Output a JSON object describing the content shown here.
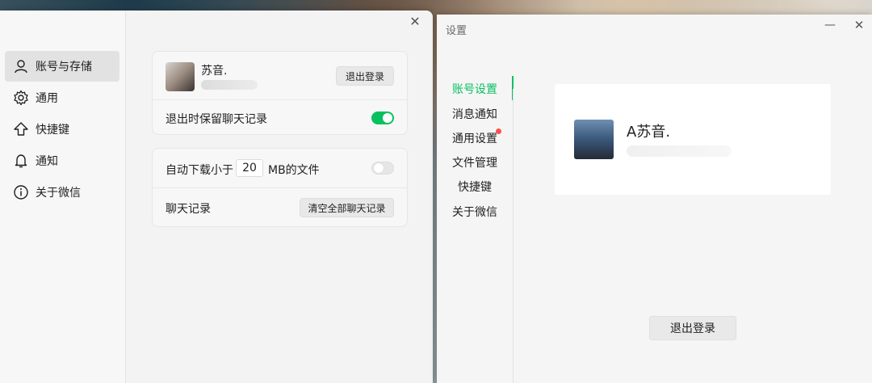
{
  "left_window": {
    "close_icon": "close-icon",
    "sidebar": {
      "items": [
        {
          "label": "账号与存储",
          "icon": "user-icon",
          "active": true
        },
        {
          "label": "通用",
          "icon": "gear-icon",
          "active": false
        },
        {
          "label": "快捷键",
          "icon": "shortcut-arrow-icon",
          "active": false
        },
        {
          "label": "通知",
          "icon": "bell-icon",
          "active": false
        },
        {
          "label": "关于微信",
          "icon": "info-icon",
          "active": false
        }
      ]
    },
    "account": {
      "nickname": "苏音.",
      "logout_label": "退出登录",
      "keep_history_label": "退出时保留聊天记录",
      "keep_history_on": true
    },
    "storage": {
      "auto_download_prefix": "自动下载小于",
      "auto_download_size": "20",
      "auto_download_suffix": "MB的文件",
      "auto_download_on": false,
      "history_label": "聊天记录",
      "clear_history_label": "清空全部聊天记录"
    }
  },
  "right_window": {
    "title": "设置",
    "minimize_icon": "minimize-icon",
    "close_icon": "close-icon",
    "nav": [
      {
        "label": "账号设置",
        "active": true
      },
      {
        "label": "消息通知",
        "active": false
      },
      {
        "label": "通用设置",
        "active": false,
        "badge": "red-dot"
      },
      {
        "label": "文件管理",
        "active": false
      },
      {
        "label": "快捷键",
        "active": false
      },
      {
        "label": "关于微信",
        "active": false
      }
    ],
    "profile": {
      "name": "A苏音."
    },
    "logout_label": "退出登录"
  },
  "colors": {
    "accent_green": "#07c160",
    "badge_red": "#fa5151"
  }
}
